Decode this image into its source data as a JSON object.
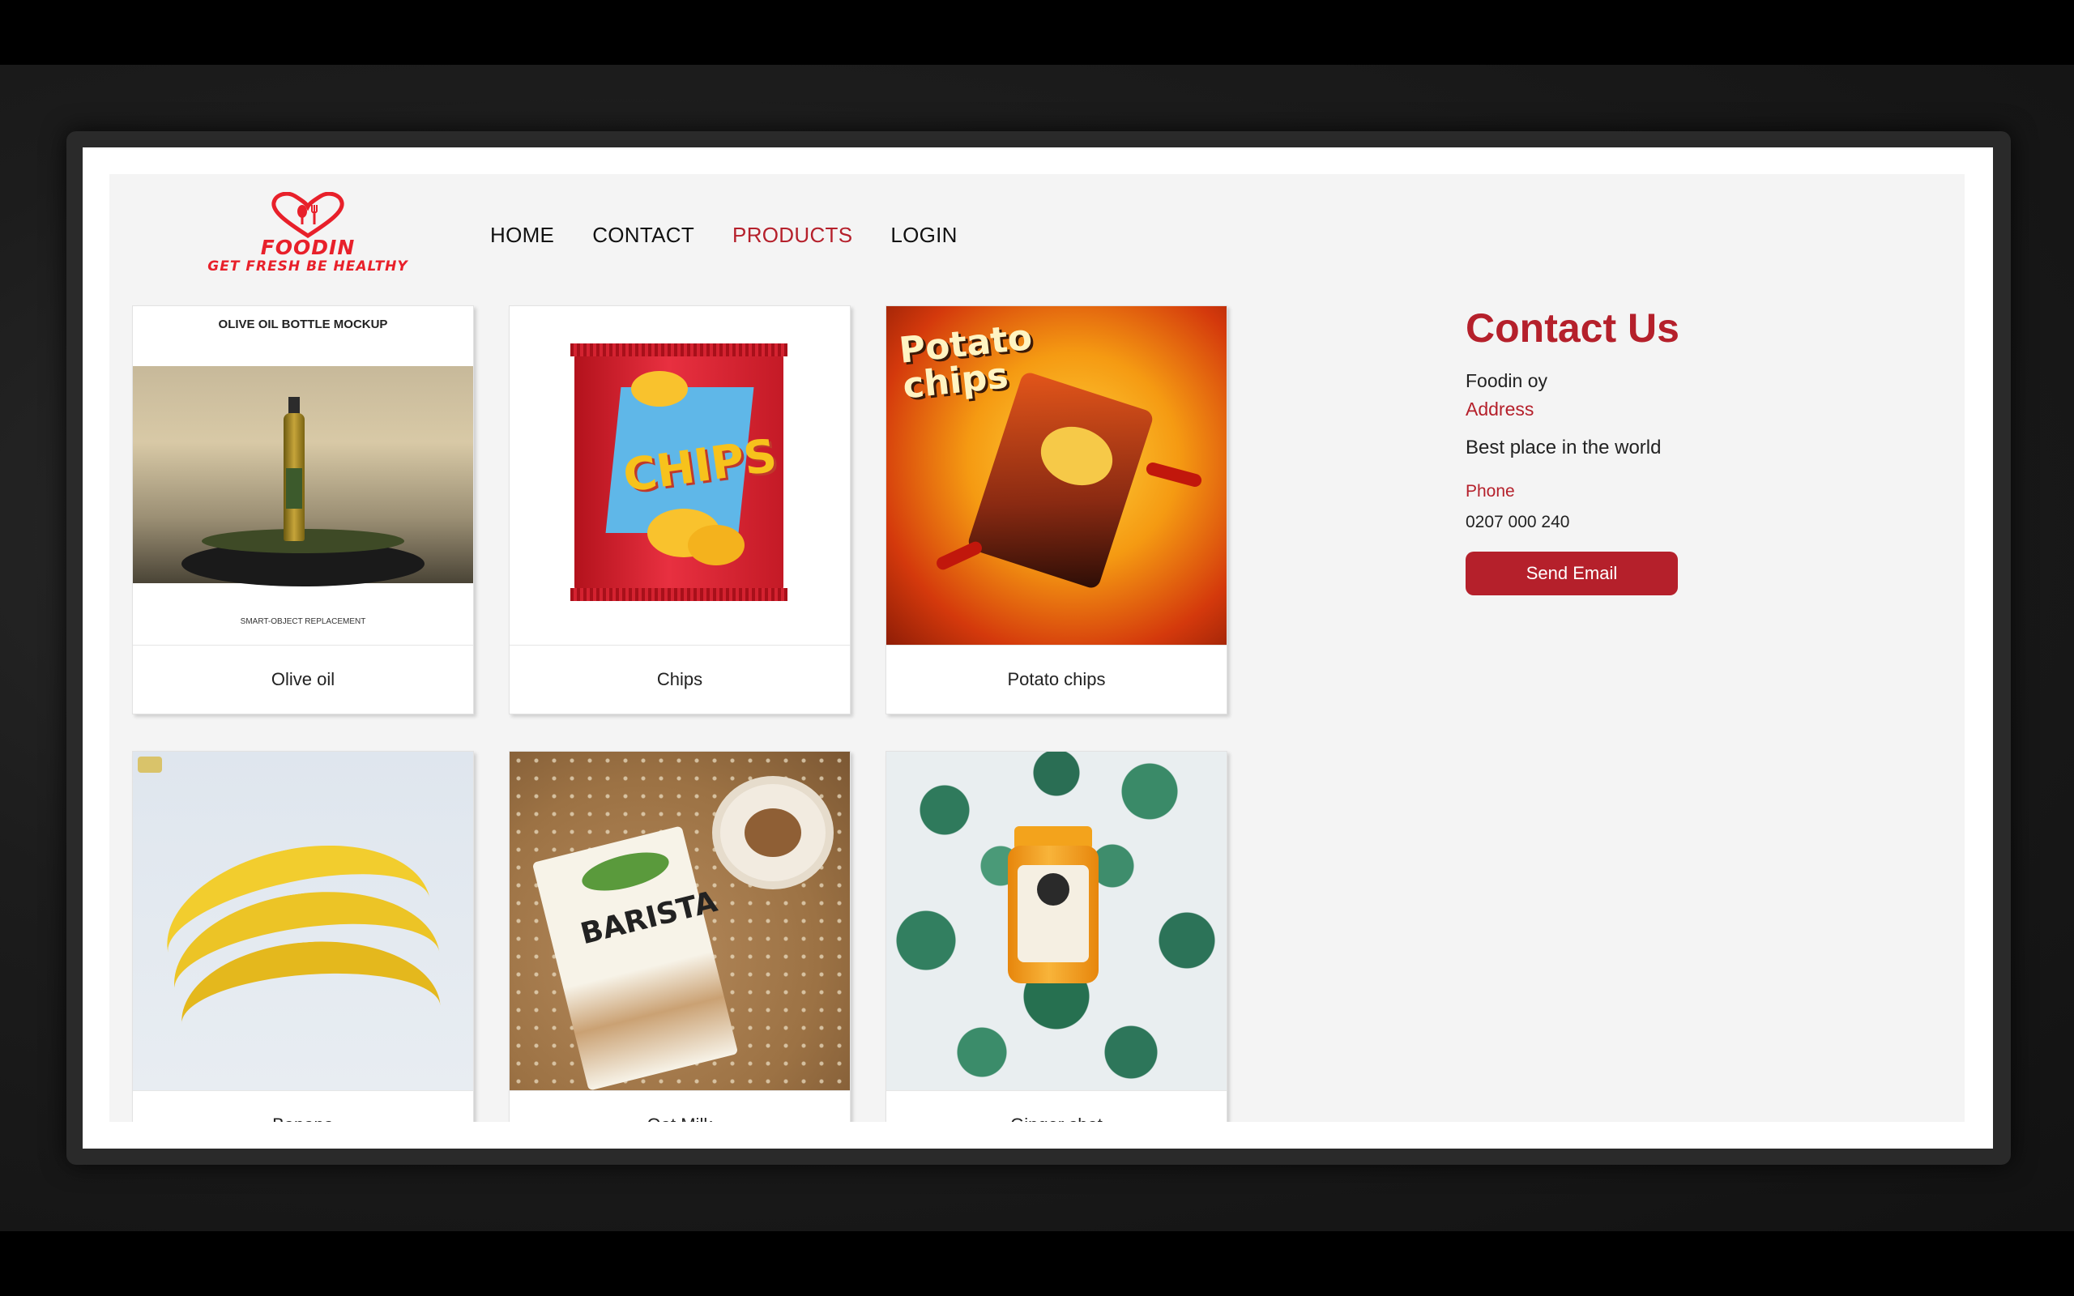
{
  "brand": {
    "name": "FOODIN",
    "tagline": "GET FRESH BE HEALTHY",
    "color": "#e8202a"
  },
  "nav": {
    "items": [
      {
        "label": "HOME",
        "active": false
      },
      {
        "label": "CONTACT",
        "active": false
      },
      {
        "label": "PRODUCTS",
        "active": true
      },
      {
        "label": "LOGIN",
        "active": false
      }
    ]
  },
  "products": [
    {
      "name": "Olive oil",
      "image_caption_top": "OLIVE OIL BOTTLE MOCKUP",
      "image_caption_bottom": "SMART-OBJECT REPLACEMENT"
    },
    {
      "name": "Chips",
      "image_text": "CHIPS"
    },
    {
      "name": "Potato chips",
      "image_text": "Potato chips"
    },
    {
      "name": "Banana"
    },
    {
      "name": "Oat Milk",
      "image_text": "BARISTA"
    },
    {
      "name": "Ginger shot"
    }
  ],
  "contact": {
    "title": "Contact Us",
    "company": "Foodin oy",
    "address_label": "Address",
    "address": "Best place in the world",
    "phone_label": "Phone",
    "phone": "0207 000 240",
    "button_label": "Send Email"
  },
  "colors": {
    "accent": "#b5202b",
    "page_background": "#f4f4f4"
  }
}
